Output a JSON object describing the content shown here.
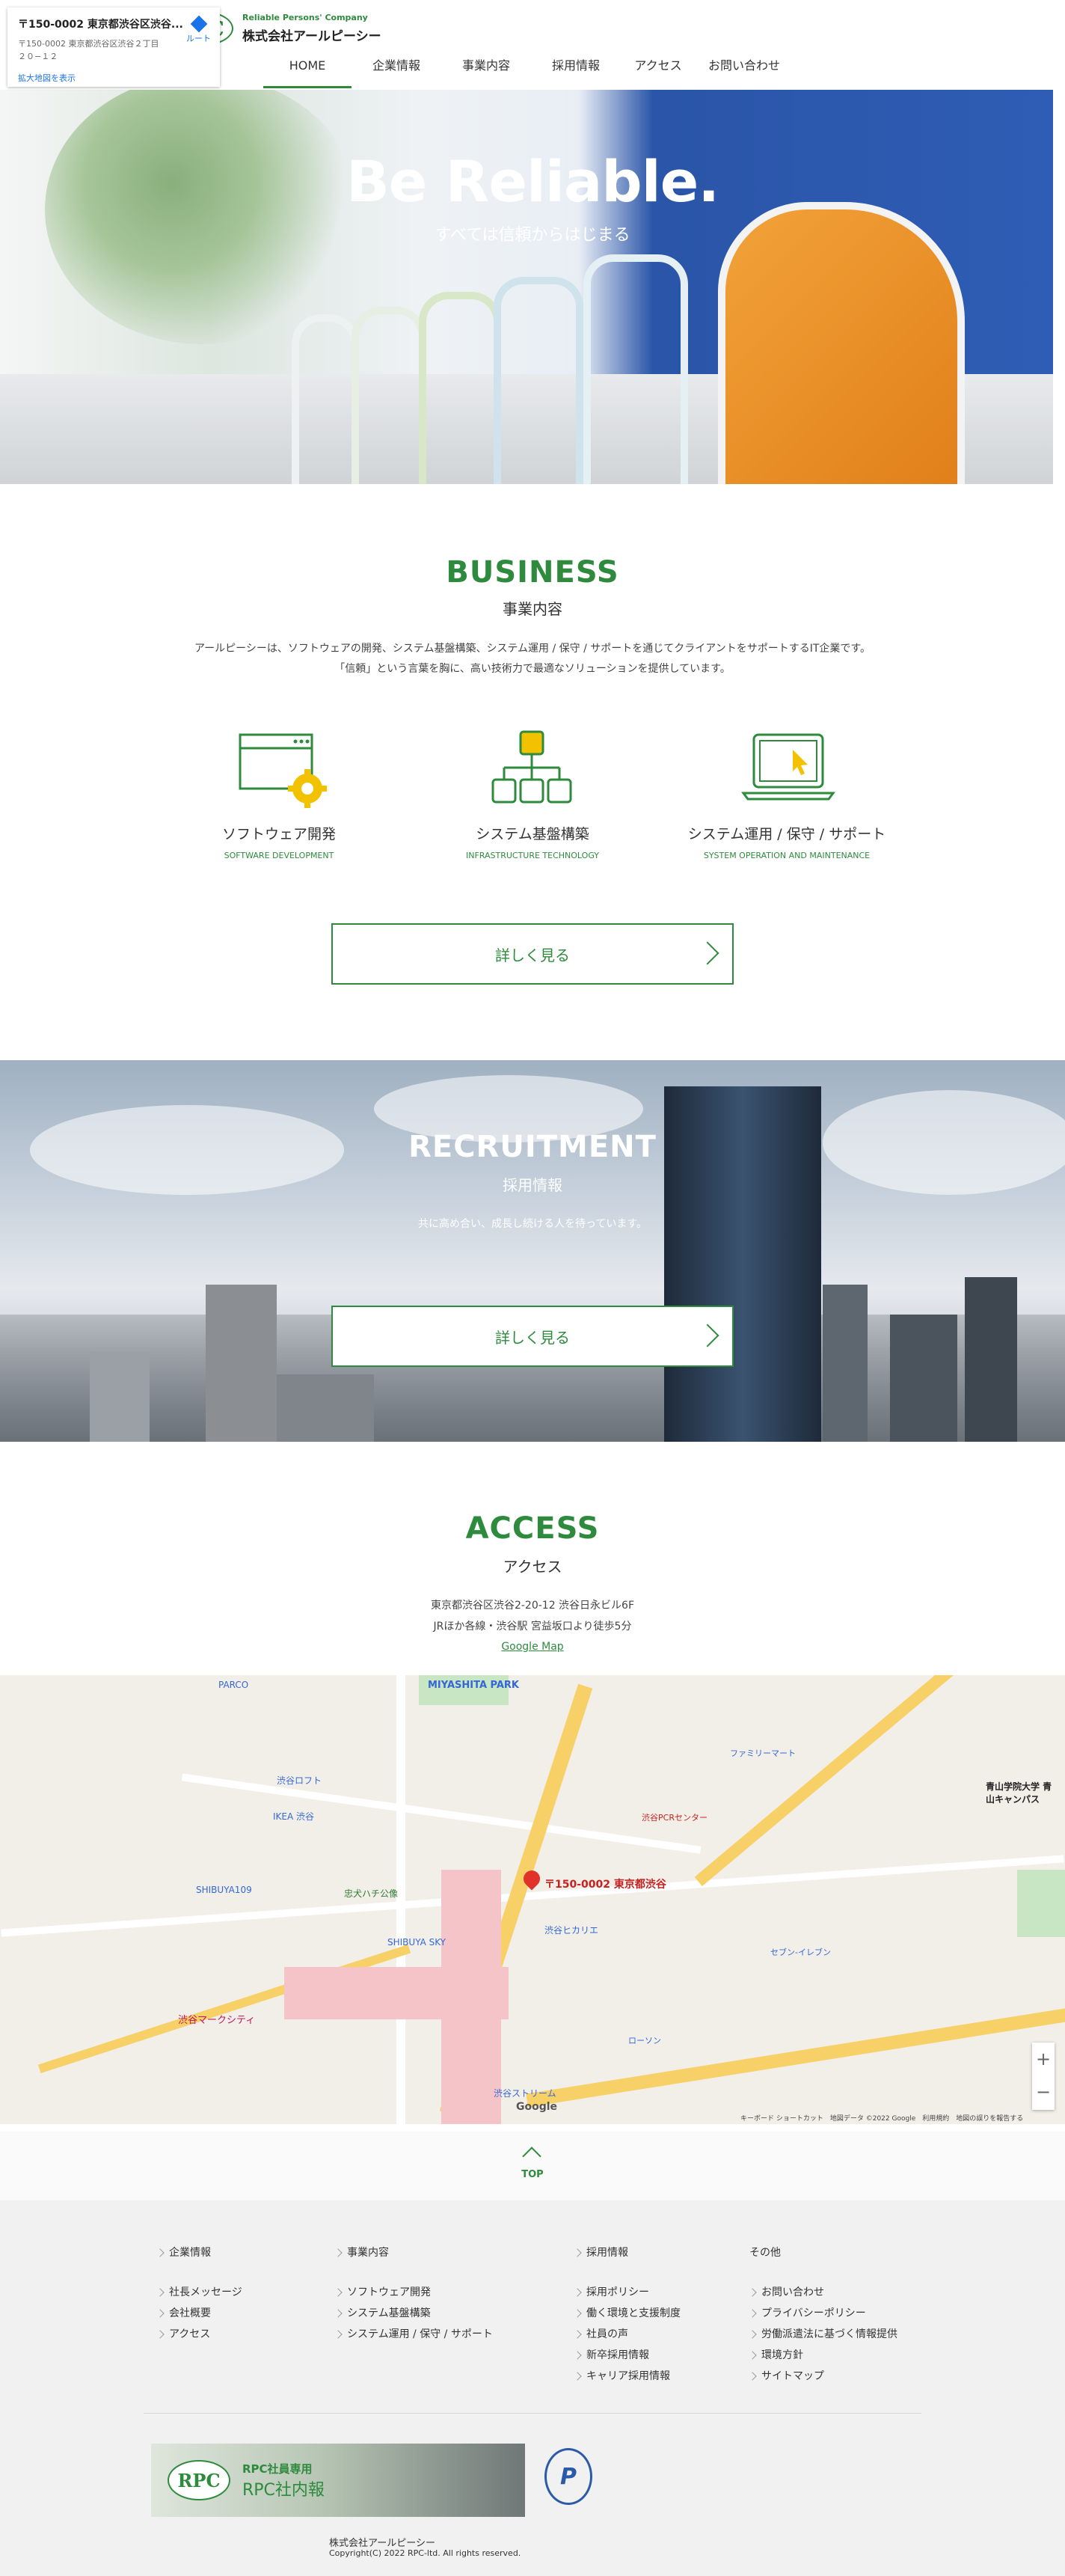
{
  "header": {
    "logo_mark": "RPC",
    "logo_sub": "Reliable Persons' Company",
    "logo_name": "株式会社アールピーシー",
    "nav": [
      "HOME",
      "企業情報",
      "事業内容",
      "採用情報",
      "アクセス",
      "お問い合わせ"
    ],
    "active": "HOME"
  },
  "hero": {
    "title": "Be Reliable.",
    "subtitle": "すべては信頼からはじまる"
  },
  "business": {
    "title": "BUSINESS",
    "subtitle": "事業内容",
    "text_line1": "アールピーシーは、ソフトウェアの開発、システム基盤構築、システム運用 / 保守 / サポートを通じてクライアントをサポートするIT企業です。",
    "text_line2": "「信頼」という言葉を胸に、高い技術力で最適なソリューションを提供しています。",
    "items": [
      {
        "name": "ソフトウェア開発",
        "en": "SOFTWARE DEVELOPMENT",
        "icon": "browser-gear-icon"
      },
      {
        "name": "システム基盤構築",
        "en": "INFRASTRUCTURE TECHNOLOGY",
        "icon": "network-tree-icon"
      },
      {
        "name": "システム運用 / 保守 / サポート",
        "en": "SYSTEM OPERATION AND MAINTENANCE",
        "icon": "laptop-cursor-icon"
      }
    ],
    "button": "詳しく見る"
  },
  "recruitment": {
    "title": "RECRUITMENT",
    "subtitle": "採用情報",
    "text": "共に高め合い、成長し続ける人を待っています。",
    "button": "詳しく見る"
  },
  "access": {
    "title": "ACCESS",
    "subtitle": "アクセス",
    "address": "東京都渋谷区渋谷2-20-12 渋谷日永ビル6F",
    "station": "JRほか各線・渋谷駅 宮益坂口より徒歩5分",
    "map_link": "Google Map"
  },
  "map": {
    "card_title": "〒150-0002 東京都渋谷区渋谷...",
    "card_addr1": "〒150-0002 東京都渋谷区渋谷２丁目",
    "card_addr2": "２０−１２",
    "card_link": "拡大地図を表示",
    "route": "ルート",
    "pin_label": "〒150-0002 東京都渋谷",
    "labels": [
      "MIYASHITA PARK",
      "PARCO",
      "渋谷ロフト",
      "IKEA 渋谷",
      "SHIBUYA109",
      "忠犬ハチ公像",
      "渋谷マークシティ",
      "SHIBUYA SKY",
      "渋谷ヒカリエ",
      "渋谷ストリーム",
      "青山学院大学 青山キャンパス",
      "渋谷PCRセンター",
      "ファミリーマート",
      "セブン-イレブン",
      "ローソン"
    ],
    "zoom_in": "+",
    "zoom_out": "−",
    "google": "Google",
    "footer": "キーボード ショートカット　地図データ ©2022 Google　利用規約　地図の誤りを報告する"
  },
  "top": "TOP",
  "footer": {
    "columns": [
      {
        "head": "企業情報",
        "head_link": true,
        "links": [
          "社長メッセージ",
          "会社概要",
          "アクセス"
        ]
      },
      {
        "head": "事業内容",
        "head_link": true,
        "links": [
          "ソフトウェア開発",
          "システム基盤構築",
          "システム運用 / 保守 / サポート"
        ]
      },
      {
        "head": "採用情報",
        "head_link": true,
        "links": [
          "採用ポリシー",
          "働く環境と支援制度",
          "社員の声",
          "新卒採用情報",
          "キャリア採用情報"
        ]
      },
      {
        "head": "その他",
        "head_link": false,
        "links": [
          "お問い合わせ",
          "プライバシーポリシー",
          "労働派遣法に基づく情報提供",
          "環境方針",
          "サイトマップ"
        ]
      }
    ],
    "banner_mark": "RPC",
    "banner_t1": "RPC社員専用",
    "banner_t2": "RPC社内報",
    "pmark": "P",
    "company": "株式会社アールピーシー",
    "copyright": "Copyright(C) 2022 RPC-ltd. All rights reserved."
  },
  "colors": {
    "accent": "#2e8b3d",
    "icon_yellow": "#f2c200"
  }
}
